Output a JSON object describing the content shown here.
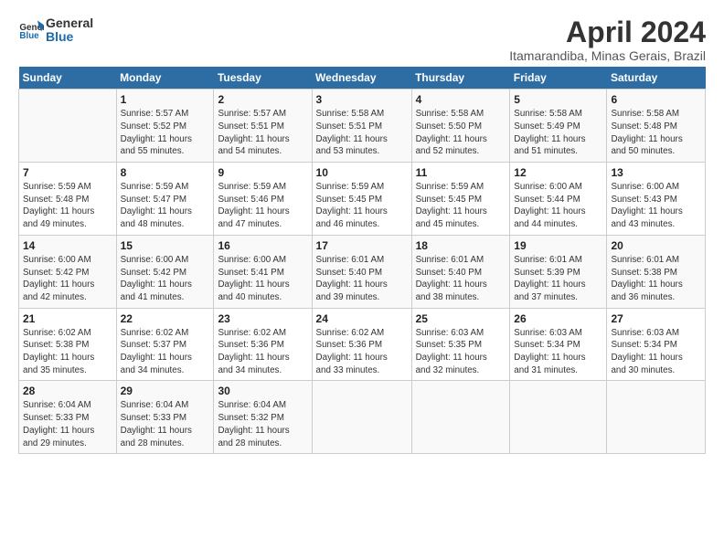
{
  "header": {
    "logo_line1": "General",
    "logo_line2": "Blue",
    "title": "April 2024",
    "subtitle": "Itamarandiba, Minas Gerais, Brazil"
  },
  "columns": [
    "Sunday",
    "Monday",
    "Tuesday",
    "Wednesday",
    "Thursday",
    "Friday",
    "Saturday"
  ],
  "weeks": [
    [
      {
        "day": "",
        "info": ""
      },
      {
        "day": "1",
        "info": "Sunrise: 5:57 AM\nSunset: 5:52 PM\nDaylight: 11 hours\nand 55 minutes."
      },
      {
        "day": "2",
        "info": "Sunrise: 5:57 AM\nSunset: 5:51 PM\nDaylight: 11 hours\nand 54 minutes."
      },
      {
        "day": "3",
        "info": "Sunrise: 5:58 AM\nSunset: 5:51 PM\nDaylight: 11 hours\nand 53 minutes."
      },
      {
        "day": "4",
        "info": "Sunrise: 5:58 AM\nSunset: 5:50 PM\nDaylight: 11 hours\nand 52 minutes."
      },
      {
        "day": "5",
        "info": "Sunrise: 5:58 AM\nSunset: 5:49 PM\nDaylight: 11 hours\nand 51 minutes."
      },
      {
        "day": "6",
        "info": "Sunrise: 5:58 AM\nSunset: 5:48 PM\nDaylight: 11 hours\nand 50 minutes."
      }
    ],
    [
      {
        "day": "7",
        "info": "Sunrise: 5:59 AM\nSunset: 5:48 PM\nDaylight: 11 hours\nand 49 minutes."
      },
      {
        "day": "8",
        "info": "Sunrise: 5:59 AM\nSunset: 5:47 PM\nDaylight: 11 hours\nand 48 minutes."
      },
      {
        "day": "9",
        "info": "Sunrise: 5:59 AM\nSunset: 5:46 PM\nDaylight: 11 hours\nand 47 minutes."
      },
      {
        "day": "10",
        "info": "Sunrise: 5:59 AM\nSunset: 5:45 PM\nDaylight: 11 hours\nand 46 minutes."
      },
      {
        "day": "11",
        "info": "Sunrise: 5:59 AM\nSunset: 5:45 PM\nDaylight: 11 hours\nand 45 minutes."
      },
      {
        "day": "12",
        "info": "Sunrise: 6:00 AM\nSunset: 5:44 PM\nDaylight: 11 hours\nand 44 minutes."
      },
      {
        "day": "13",
        "info": "Sunrise: 6:00 AM\nSunset: 5:43 PM\nDaylight: 11 hours\nand 43 minutes."
      }
    ],
    [
      {
        "day": "14",
        "info": "Sunrise: 6:00 AM\nSunset: 5:42 PM\nDaylight: 11 hours\nand 42 minutes."
      },
      {
        "day": "15",
        "info": "Sunrise: 6:00 AM\nSunset: 5:42 PM\nDaylight: 11 hours\nand 41 minutes."
      },
      {
        "day": "16",
        "info": "Sunrise: 6:00 AM\nSunset: 5:41 PM\nDaylight: 11 hours\nand 40 minutes."
      },
      {
        "day": "17",
        "info": "Sunrise: 6:01 AM\nSunset: 5:40 PM\nDaylight: 11 hours\nand 39 minutes."
      },
      {
        "day": "18",
        "info": "Sunrise: 6:01 AM\nSunset: 5:40 PM\nDaylight: 11 hours\nand 38 minutes."
      },
      {
        "day": "19",
        "info": "Sunrise: 6:01 AM\nSunset: 5:39 PM\nDaylight: 11 hours\nand 37 minutes."
      },
      {
        "day": "20",
        "info": "Sunrise: 6:01 AM\nSunset: 5:38 PM\nDaylight: 11 hours\nand 36 minutes."
      }
    ],
    [
      {
        "day": "21",
        "info": "Sunrise: 6:02 AM\nSunset: 5:38 PM\nDaylight: 11 hours\nand 35 minutes."
      },
      {
        "day": "22",
        "info": "Sunrise: 6:02 AM\nSunset: 5:37 PM\nDaylight: 11 hours\nand 34 minutes."
      },
      {
        "day": "23",
        "info": "Sunrise: 6:02 AM\nSunset: 5:36 PM\nDaylight: 11 hours\nand 34 minutes."
      },
      {
        "day": "24",
        "info": "Sunrise: 6:02 AM\nSunset: 5:36 PM\nDaylight: 11 hours\nand 33 minutes."
      },
      {
        "day": "25",
        "info": "Sunrise: 6:03 AM\nSunset: 5:35 PM\nDaylight: 11 hours\nand 32 minutes."
      },
      {
        "day": "26",
        "info": "Sunrise: 6:03 AM\nSunset: 5:34 PM\nDaylight: 11 hours\nand 31 minutes."
      },
      {
        "day": "27",
        "info": "Sunrise: 6:03 AM\nSunset: 5:34 PM\nDaylight: 11 hours\nand 30 minutes."
      }
    ],
    [
      {
        "day": "28",
        "info": "Sunrise: 6:04 AM\nSunset: 5:33 PM\nDaylight: 11 hours\nand 29 minutes."
      },
      {
        "day": "29",
        "info": "Sunrise: 6:04 AM\nSunset: 5:33 PM\nDaylight: 11 hours\nand 28 minutes."
      },
      {
        "day": "30",
        "info": "Sunrise: 6:04 AM\nSunset: 5:32 PM\nDaylight: 11 hours\nand 28 minutes."
      },
      {
        "day": "",
        "info": ""
      },
      {
        "day": "",
        "info": ""
      },
      {
        "day": "",
        "info": ""
      },
      {
        "day": "",
        "info": ""
      }
    ]
  ]
}
